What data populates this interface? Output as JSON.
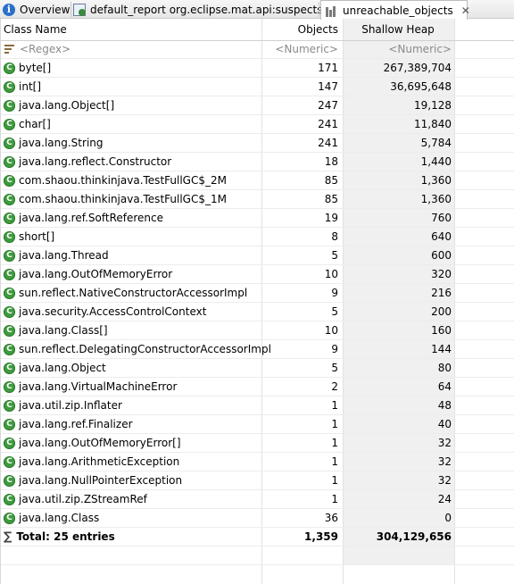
{
  "tabs": [
    {
      "label": "Overview",
      "icon": "info-icon"
    },
    {
      "label": "default_report  org.eclipse.mat.api:suspects",
      "icon": "report-icon"
    },
    {
      "label": "unreachable_objects",
      "icon": "histogram-icon",
      "close": "✕"
    }
  ],
  "columns": {
    "name": "Class Name",
    "objects": "Objects",
    "shallow": "Shallow Heap"
  },
  "filters": {
    "name": "<Regex>",
    "objects": "<Numeric>",
    "shallow": "<Numeric>"
  },
  "rows": [
    {
      "name": "byte[]",
      "objects": "171",
      "shallow": "267,389,704"
    },
    {
      "name": "int[]",
      "objects": "147",
      "shallow": "36,695,648"
    },
    {
      "name": "java.lang.Object[]",
      "objects": "247",
      "shallow": "19,128"
    },
    {
      "name": "char[]",
      "objects": "241",
      "shallow": "11,840"
    },
    {
      "name": "java.lang.String",
      "objects": "241",
      "shallow": "5,784"
    },
    {
      "name": "java.lang.reflect.Constructor",
      "objects": "18",
      "shallow": "1,440"
    },
    {
      "name": "com.shaou.thinkinjava.TestFullGC$_2M",
      "objects": "85",
      "shallow": "1,360"
    },
    {
      "name": "com.shaou.thinkinjava.TestFullGC$_1M",
      "objects": "85",
      "shallow": "1,360"
    },
    {
      "name": "java.lang.ref.SoftReference",
      "objects": "19",
      "shallow": "760"
    },
    {
      "name": "short[]",
      "objects": "8",
      "shallow": "640"
    },
    {
      "name": "java.lang.Thread",
      "objects": "5",
      "shallow": "600"
    },
    {
      "name": "java.lang.OutOfMemoryError",
      "objects": "10",
      "shallow": "320"
    },
    {
      "name": "sun.reflect.NativeConstructorAccessorImpl",
      "objects": "9",
      "shallow": "216"
    },
    {
      "name": "java.security.AccessControlContext",
      "objects": "5",
      "shallow": "200"
    },
    {
      "name": "java.lang.Class[]",
      "objects": "10",
      "shallow": "160"
    },
    {
      "name": "sun.reflect.DelegatingConstructorAccessorImpl",
      "objects": "9",
      "shallow": "144"
    },
    {
      "name": "java.lang.Object",
      "objects": "5",
      "shallow": "80"
    },
    {
      "name": "java.lang.VirtualMachineError",
      "objects": "2",
      "shallow": "64"
    },
    {
      "name": "java.util.zip.Inflater",
      "objects": "1",
      "shallow": "48"
    },
    {
      "name": "java.lang.ref.Finalizer",
      "objects": "1",
      "shallow": "40"
    },
    {
      "name": "java.lang.OutOfMemoryError[]",
      "objects": "1",
      "shallow": "32"
    },
    {
      "name": "java.lang.ArithmeticException",
      "objects": "1",
      "shallow": "32"
    },
    {
      "name": "java.lang.NullPointerException",
      "objects": "1",
      "shallow": "32"
    },
    {
      "name": "java.util.zip.ZStreamRef",
      "objects": "1",
      "shallow": "24"
    },
    {
      "name": "java.lang.Class",
      "objects": "36",
      "shallow": "0"
    }
  ],
  "total": {
    "label": "Total: 25 entries",
    "objects": "1,359",
    "shallow": "304,129,656",
    "icon": "sigma-icon"
  },
  "class_icon_letter": "C",
  "colors": {
    "class_icon": "#3e9b3e",
    "sorted_column_bg": "#f0f0f0",
    "info_icon": "#2a6fc9"
  }
}
